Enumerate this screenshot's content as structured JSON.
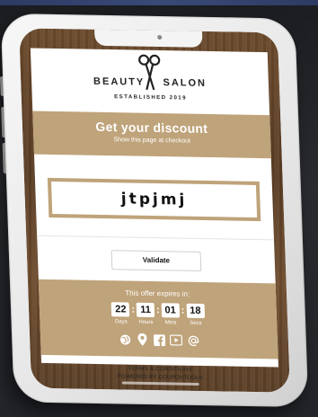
{
  "logo": {
    "word_left": "BEAUTY",
    "word_right": "SALON",
    "tagline": "ESTABLISHED 2019",
    "icon": "scissors-icon"
  },
  "banner": {
    "title": "Get your discount",
    "subtitle": "Show this page at checkout"
  },
  "coupon": {
    "code": "jtpjmj"
  },
  "validate_label": "Validate",
  "offer": {
    "expires_label": "This offer expires in:",
    "timer": [
      {
        "value": "22",
        "label": "Days"
      },
      {
        "value": "11",
        "label": "Hours"
      },
      {
        "value": "01",
        "label": "Mins"
      },
      {
        "value": "18",
        "label": "Secs"
      }
    ],
    "icons": [
      "globe-icon",
      "location-pin-icon",
      "facebook-icon",
      "youtube-icon",
      "at-sign-icon"
    ]
  },
  "footer": {
    "terms": "TERMS & CONDITIONS",
    "powered": "POWERED BY COUPONTOOLS"
  },
  "colors": {
    "accent": "#bfa37a",
    "wood": "#6b4a2c",
    "background": "#23252a"
  }
}
